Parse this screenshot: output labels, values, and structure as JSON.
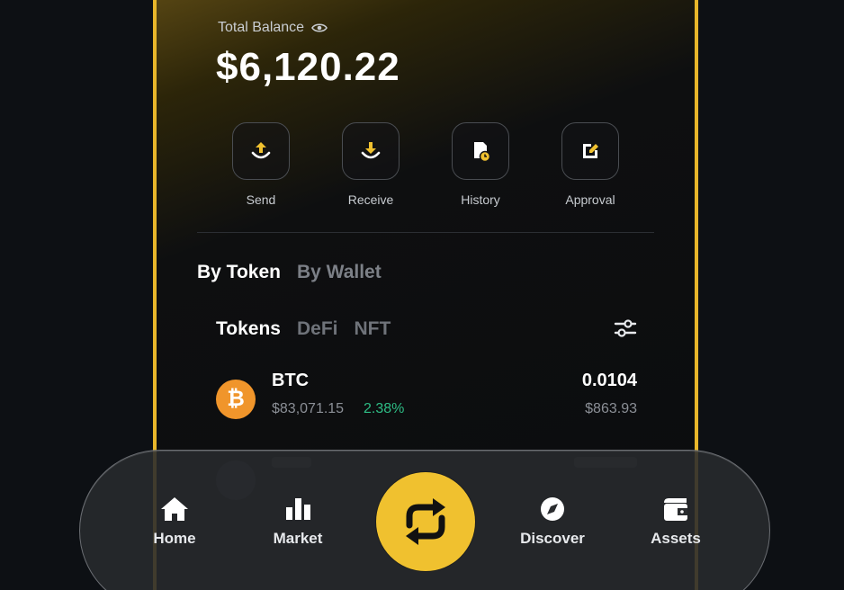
{
  "balance": {
    "label": "Total Balance",
    "value": "$6,120.22"
  },
  "actions": [
    {
      "label": "Send",
      "icon": "send-icon"
    },
    {
      "label": "Receive",
      "icon": "receive-icon"
    },
    {
      "label": "History",
      "icon": "history-icon"
    },
    {
      "label": "Approval",
      "icon": "approval-icon"
    }
  ],
  "view_tabs": [
    {
      "label": "By Token",
      "active": true
    },
    {
      "label": "By Wallet",
      "active": false
    }
  ],
  "asset_tabs": [
    {
      "label": "Tokens",
      "active": true
    },
    {
      "label": "DeFi",
      "active": false
    },
    {
      "label": "NFT",
      "active": false
    }
  ],
  "tokens": [
    {
      "symbol": "BTC",
      "icon_char": "₿",
      "price": "$83,071.15",
      "change": "2.38%",
      "amount": "0.0104",
      "value": "$863.93"
    }
  ],
  "nav": {
    "items": [
      {
        "label": "Home",
        "icon": "home-icon"
      },
      {
        "label": "Market",
        "icon": "market-icon"
      },
      {
        "label": "Discover",
        "icon": "discover-icon"
      },
      {
        "label": "Assets",
        "icon": "assets-icon"
      }
    ],
    "center_icon": "swap-icon"
  },
  "colors": {
    "accent": "#f0c12f",
    "border_gold": "#e8b62a",
    "positive": "#2ebd85",
    "btc": "#f0952b"
  }
}
